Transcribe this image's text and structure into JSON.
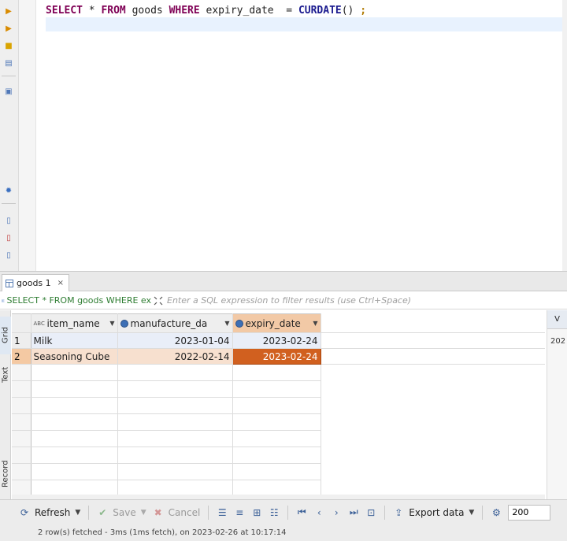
{
  "editor": {
    "sql_parts": [
      "SELECT",
      " * ",
      "FROM",
      " goods ",
      "WHERE",
      " expiry_date  = ",
      "CURDATE",
      "() ",
      ";"
    ]
  },
  "results_tab": {
    "label": "goods 1",
    "close_glyph": "×"
  },
  "filter": {
    "query": "SELECT * FROM goods WHERE ex",
    "placeholder": "Enter a SQL expression to filter results (use Ctrl+Space)"
  },
  "side_tabs": {
    "grid": "Grid",
    "text": "Text",
    "record": "Record"
  },
  "grid": {
    "columns": [
      {
        "type_badge": "ABC",
        "name": "item_name",
        "icon": "text-type-icon"
      },
      {
        "type_badge": "",
        "name": "manufacture_da",
        "icon": "date-type-icon"
      },
      {
        "type_badge": "",
        "name": "expiry_date",
        "icon": "date-type-icon"
      }
    ],
    "rows": [
      {
        "num": "1",
        "item_name": "Milk",
        "manufacture_date": "2023-01-04",
        "expiry_date": "2023-02-24"
      },
      {
        "num": "2",
        "item_name": "Seasoning Cube",
        "manufacture_date": "2022-02-14",
        "expiry_date": "2023-02-24"
      }
    ]
  },
  "value_panel": {
    "header": "V",
    "value": "202"
  },
  "toolbar": {
    "refresh": "Refresh",
    "save": "Save",
    "cancel": "Cancel",
    "export": "Export data",
    "fetch_size": "200"
  },
  "status": {
    "text": "2 row(s) fetched - 3ms (1ms fetch), on 2023-02-26 at 10:17:14"
  },
  "colors": {
    "keyword": "#7f0055",
    "selected_cell": "#d1601f",
    "selected_row": "#f7e0cf",
    "filter_text": "#2e7d32"
  }
}
